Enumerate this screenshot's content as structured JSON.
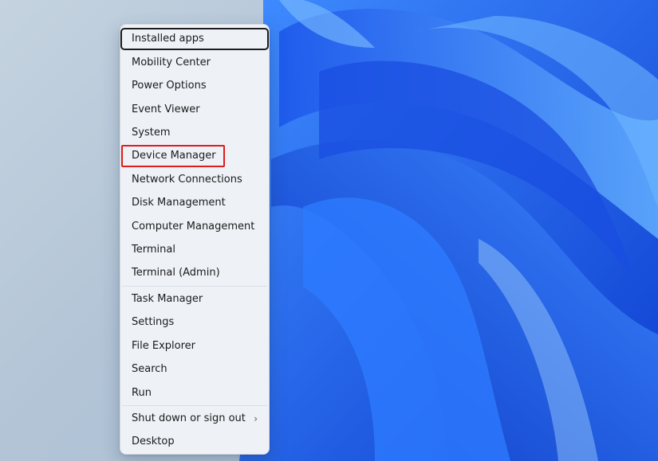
{
  "menu": {
    "items": [
      {
        "label": "Installed apps"
      },
      {
        "label": "Mobility Center"
      },
      {
        "label": "Power Options"
      },
      {
        "label": "Event Viewer"
      },
      {
        "label": "System"
      },
      {
        "label": "Device Manager"
      },
      {
        "label": "Network Connections"
      },
      {
        "label": "Disk Management"
      },
      {
        "label": "Computer Management"
      },
      {
        "label": "Terminal"
      },
      {
        "label": "Terminal (Admin)"
      },
      {
        "label": "Task Manager"
      },
      {
        "label": "Settings"
      },
      {
        "label": "File Explorer"
      },
      {
        "label": "Search"
      },
      {
        "label": "Run"
      },
      {
        "label": "Shut down or sign out",
        "submenu_icon": "chevron-right-icon"
      },
      {
        "label": "Desktop"
      }
    ],
    "focused_item": "Installed apps",
    "highlighted_item": "Device Manager",
    "highlight_color": "#e01b1b",
    "chevron_glyph": "›"
  },
  "wallpaper": {
    "description_colors": [
      "#1f5cf2",
      "#2b78ff",
      "#0f3fc9",
      "#5aa6ff"
    ]
  }
}
